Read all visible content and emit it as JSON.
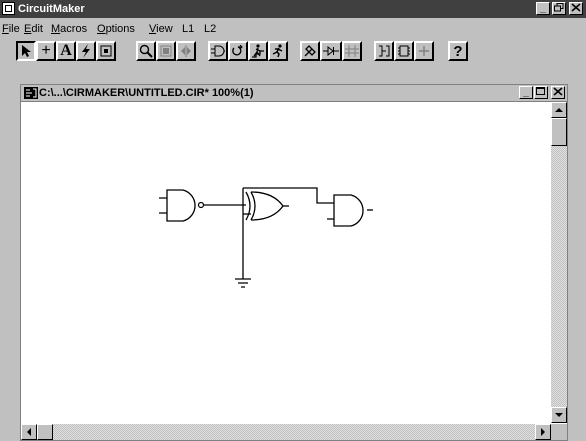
{
  "app": {
    "title": "CircuitMaker",
    "window_controls": [
      "_",
      "×",
      "✕"
    ]
  },
  "menu": {
    "items": [
      {
        "key": "F",
        "rest": "ile"
      },
      {
        "key": "E",
        "rest": "dit"
      },
      {
        "key": "M",
        "rest": "acros"
      },
      {
        "key": "O",
        "rest": "ptions"
      },
      {
        "key": "V",
        "rest": "iew"
      },
      {
        "key": "",
        "rest": "L1"
      },
      {
        "key": "",
        "rest": "L2"
      }
    ]
  },
  "toolbar": {
    "text_tool_label": "A",
    "wire_tool_label": "+",
    "help_label": "?",
    "icons": [
      "arrow-pointer-icon",
      "wire-cross-icon",
      "text-tool-icon",
      "lightning-icon",
      "probe-icon",
      "zoom-icon",
      "rotate-icon",
      "mirror-icon",
      "gate-device-icon",
      "loop-icon",
      "stepper-icon",
      "runner-icon",
      "probe-pen-icon",
      "diode-icon",
      "grid-icon",
      "bus-icon",
      "chip-icon",
      "cross-icon",
      "help-icon"
    ]
  },
  "document": {
    "title": "C:\\...\\CIRMAKER\\UNTITLED.CIR* 100%(1)",
    "controls": [
      "_",
      "□",
      "×"
    ]
  },
  "circuit": {
    "components": [
      "nand-gate",
      "xor-gate",
      "and-gate",
      "ground-symbol"
    ]
  },
  "colors": {
    "title_bar": "#404040",
    "chrome": "#c0c0c0",
    "canvas": "#ffffff"
  }
}
